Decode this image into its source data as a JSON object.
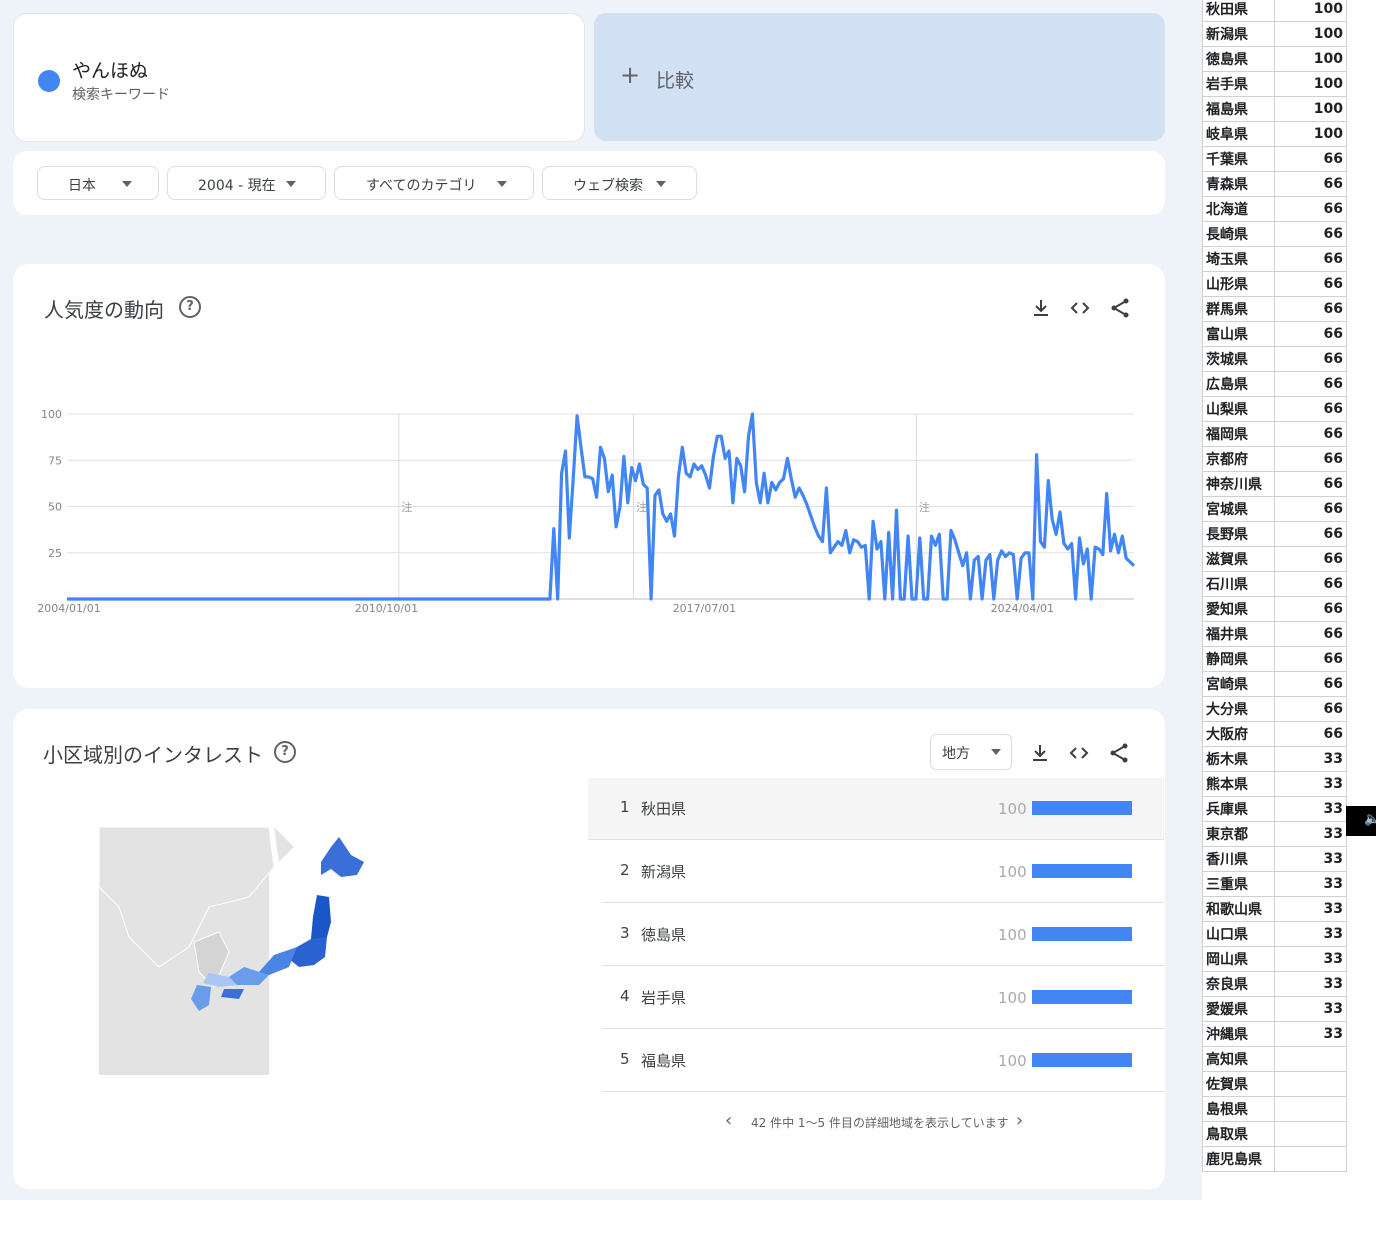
{
  "search_term": {
    "name": "やんほぬ",
    "subtitle": "検索キーワード",
    "color": "#4285f4"
  },
  "compare": {
    "label": "比較"
  },
  "filters": [
    {
      "label": "日本"
    },
    {
      "label": "2004 - 現在"
    },
    {
      "label": "すべてのカテゴリ"
    },
    {
      "label": "ウェブ検索"
    }
  ],
  "trend": {
    "title": "人気度の動向",
    "note_marker": "注"
  },
  "chart_data": {
    "type": "line",
    "x_tick_labels": [
      "2004/01/01",
      "2010/10/01",
      "2017/07/01",
      "2024/04/01"
    ],
    "y_ticks": [
      25,
      50,
      75,
      100
    ],
    "ylim": [
      0,
      100
    ],
    "grid": true,
    "series": [
      {
        "color": "#4285f4",
        "values": [
          0,
          0,
          0,
          0,
          0,
          0,
          0,
          0,
          0,
          0,
          0,
          0,
          0,
          0,
          0,
          0,
          0,
          0,
          0,
          0,
          0,
          0,
          0,
          0,
          0,
          0,
          0,
          0,
          0,
          0,
          0,
          0,
          0,
          0,
          0,
          0,
          0,
          0,
          0,
          0,
          0,
          0,
          0,
          0,
          0,
          0,
          0,
          0,
          0,
          0,
          0,
          0,
          0,
          0,
          0,
          0,
          0,
          0,
          0,
          0,
          0,
          0,
          0,
          0,
          0,
          0,
          0,
          0,
          0,
          0,
          0,
          0,
          0,
          0,
          0,
          0,
          0,
          0,
          0,
          0,
          0,
          0,
          0,
          0,
          0,
          0,
          0,
          0,
          0,
          0,
          0,
          0,
          0,
          0,
          0,
          0,
          0,
          0,
          0,
          0,
          0,
          0,
          0,
          0,
          0,
          0,
          0,
          0,
          0,
          0,
          0,
          0,
          0,
          0,
          0,
          0,
          0,
          0,
          0,
          0,
          0,
          0,
          0,
          0,
          0,
          38,
          0,
          68,
          80,
          33,
          65,
          99,
          82,
          66,
          66,
          65,
          55,
          82,
          76,
          58,
          67,
          39,
          50,
          77,
          52,
          71,
          64,
          73,
          62,
          60,
          0,
          56,
          59,
          46,
          42,
          46,
          34,
          66,
          82,
          68,
          66,
          73,
          70,
          72,
          67,
          60,
          77,
          88,
          88,
          76,
          80,
          52,
          76,
          72,
          58,
          88,
          100,
          63,
          52,
          68,
          52,
          63,
          59,
          63,
          65,
          76,
          65,
          55,
          60,
          56,
          51,
          45,
          39,
          34,
          31,
          60,
          25,
          28,
          31,
          29,
          37,
          25,
          32,
          31,
          28,
          29,
          0,
          42,
          27,
          31,
          0,
          36,
          0,
          48,
          0,
          0,
          34,
          0,
          0,
          33,
          0,
          0,
          34,
          29,
          35,
          0,
          0,
          37,
          32,
          25,
          18,
          25,
          0,
          21,
          23,
          0,
          21,
          24,
          0,
          21,
          26,
          23,
          25,
          24,
          0,
          22,
          25,
          25,
          0,
          78,
          31,
          28,
          64,
          43,
          35,
          47,
          30,
          27,
          30,
          0,
          33,
          19,
          27,
          0,
          28,
          27,
          24,
          57,
          26,
          35,
          25,
          34,
          22,
          20,
          18
        ]
      }
    ]
  },
  "regions": {
    "title": "小区域別のインタレスト",
    "resolution_label": "地方",
    "ranking": [
      {
        "rank": "1",
        "name": "秋田県",
        "value": "100",
        "pct": 100
      },
      {
        "rank": "2",
        "name": "新潟県",
        "value": "100",
        "pct": 100
      },
      {
        "rank": "3",
        "name": "徳島県",
        "value": "100",
        "pct": 100
      },
      {
        "rank": "4",
        "name": "岩手県",
        "value": "100",
        "pct": 100
      },
      {
        "rank": "5",
        "name": "福島県",
        "value": "100",
        "pct": 100
      }
    ],
    "pager_text": "42 件中 1〜5 件目の詳細地域を表示しています"
  },
  "colors": {
    "accent": "#4285f4",
    "map_dark": "#1a56c8",
    "map_mid": "#4a85e6",
    "map_light": "#a9c6f5"
  },
  "pref_table": [
    {
      "name": "秋田県",
      "value": "100"
    },
    {
      "name": "新潟県",
      "value": "100"
    },
    {
      "name": "徳島県",
      "value": "100"
    },
    {
      "name": "岩手県",
      "value": "100"
    },
    {
      "name": "福島県",
      "value": "100"
    },
    {
      "name": "岐阜県",
      "value": "100"
    },
    {
      "name": "千葉県",
      "value": "66"
    },
    {
      "name": "青森県",
      "value": "66"
    },
    {
      "name": "北海道",
      "value": "66"
    },
    {
      "name": "長崎県",
      "value": "66"
    },
    {
      "name": "埼玉県",
      "value": "66"
    },
    {
      "name": "山形県",
      "value": "66"
    },
    {
      "name": "群馬県",
      "value": "66"
    },
    {
      "name": "富山県",
      "value": "66"
    },
    {
      "name": "茨城県",
      "value": "66"
    },
    {
      "name": "広島県",
      "value": "66"
    },
    {
      "name": "山梨県",
      "value": "66"
    },
    {
      "name": "福岡県",
      "value": "66"
    },
    {
      "name": "京都府",
      "value": "66"
    },
    {
      "name": "神奈川県",
      "value": "66"
    },
    {
      "name": "宮城県",
      "value": "66"
    },
    {
      "name": "長野県",
      "value": "66"
    },
    {
      "name": "滋賀県",
      "value": "66"
    },
    {
      "name": "石川県",
      "value": "66"
    },
    {
      "name": "愛知県",
      "value": "66"
    },
    {
      "name": "福井県",
      "value": "66"
    },
    {
      "name": "静岡県",
      "value": "66"
    },
    {
      "name": "宮崎県",
      "value": "66"
    },
    {
      "name": "大分県",
      "value": "66"
    },
    {
      "name": "大阪府",
      "value": "66"
    },
    {
      "name": "栃木県",
      "value": "33"
    },
    {
      "name": "熊本県",
      "value": "33"
    },
    {
      "name": "兵庫県",
      "value": "33"
    },
    {
      "name": "東京都",
      "value": "33"
    },
    {
      "name": "香川県",
      "value": "33"
    },
    {
      "name": "三重県",
      "value": "33"
    },
    {
      "name": "和歌山県",
      "value": "33"
    },
    {
      "name": "山口県",
      "value": "33"
    },
    {
      "name": "岡山県",
      "value": "33"
    },
    {
      "name": "奈良県",
      "value": "33"
    },
    {
      "name": "愛媛県",
      "value": "33"
    },
    {
      "name": "沖縄県",
      "value": "33"
    },
    {
      "name": "高知県",
      "value": ""
    },
    {
      "name": "佐賀県",
      "value": ""
    },
    {
      "name": "島根県",
      "value": ""
    },
    {
      "name": "鳥取県",
      "value": ""
    },
    {
      "name": "鹿児島県",
      "value": ""
    }
  ]
}
